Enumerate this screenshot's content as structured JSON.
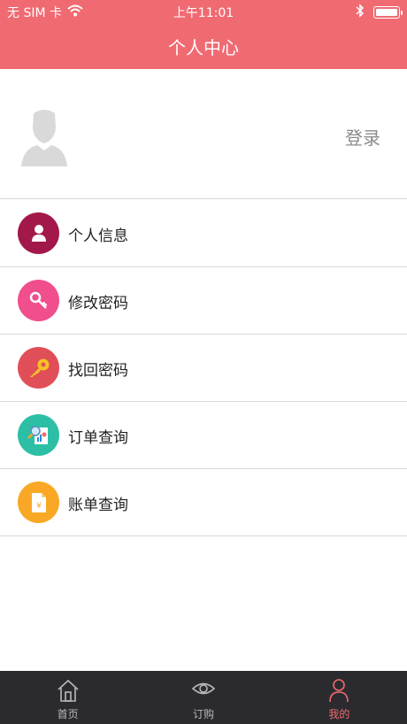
{
  "status_bar": {
    "carrier": "无 SIM 卡",
    "time": "上午11:01"
  },
  "header": {
    "title": "个人中心"
  },
  "profile": {
    "login_label": "登录"
  },
  "menu": {
    "items": [
      {
        "label": "个人信息",
        "icon": "person-icon",
        "color": "#a3184a"
      },
      {
        "label": "修改密码",
        "icon": "key-icon",
        "color": "#f04e8c"
      },
      {
        "label": "找回密码",
        "icon": "golden-key-icon",
        "color": "#e04f57"
      },
      {
        "label": "订单查询",
        "icon": "report-search-icon",
        "color": "#2cbfa6"
      },
      {
        "label": "账单查询",
        "icon": "bill-document-icon",
        "color": "#f9a825"
      }
    ]
  },
  "tabbar": {
    "tabs": [
      {
        "label": "首页",
        "icon": "home-icon"
      },
      {
        "label": "订购",
        "icon": "eye-icon"
      },
      {
        "label": "我的",
        "icon": "user-icon",
        "active": true
      }
    ]
  },
  "colors": {
    "accent": "#f06a72",
    "tabbar_bg": "#2b2b2f"
  }
}
